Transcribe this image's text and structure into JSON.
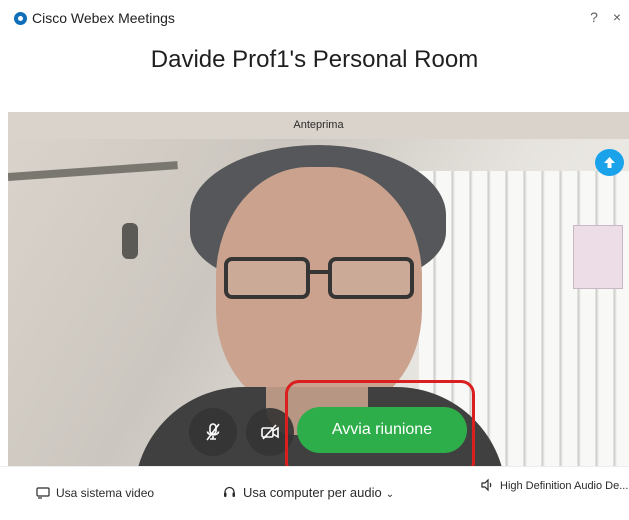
{
  "window": {
    "title": "Cisco Webex Meetings",
    "help_symbol": "?",
    "close_symbol": "×"
  },
  "meeting": {
    "title": "Davide Prof1's Personal Room"
  },
  "preview": {
    "label": "Anteprima"
  },
  "controls": {
    "mute_icon": "microphone-off-icon",
    "video_icon": "camera-off-icon",
    "start_label": "Avvia riunione",
    "badge_icon": "up-arrow-icon"
  },
  "bottom": {
    "system_video_label": "Usa sistema video",
    "audio_label": "Usa computer per audio",
    "audio_chevron": "⌄",
    "audio_device_label": "High Definition Audio De..."
  },
  "colors": {
    "start_button": "#2eae4a",
    "highlight": "#d91f1f",
    "badge": "#1aa3ea",
    "logo": "#0f6fb8"
  }
}
